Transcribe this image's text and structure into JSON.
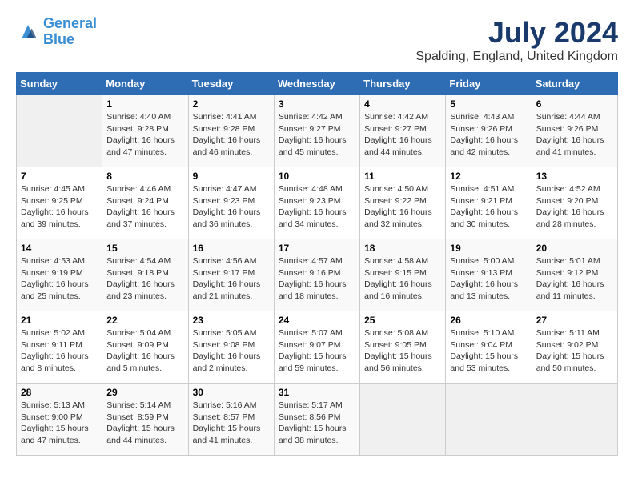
{
  "header": {
    "logo_line1": "General",
    "logo_line2": "Blue",
    "month": "July 2024",
    "location": "Spalding, England, United Kingdom"
  },
  "weekdays": [
    "Sunday",
    "Monday",
    "Tuesday",
    "Wednesday",
    "Thursday",
    "Friday",
    "Saturday"
  ],
  "weeks": [
    [
      {
        "day": "",
        "info": ""
      },
      {
        "day": "1",
        "info": "Sunrise: 4:40 AM\nSunset: 9:28 PM\nDaylight: 16 hours\nand 47 minutes."
      },
      {
        "day": "2",
        "info": "Sunrise: 4:41 AM\nSunset: 9:28 PM\nDaylight: 16 hours\nand 46 minutes."
      },
      {
        "day": "3",
        "info": "Sunrise: 4:42 AM\nSunset: 9:27 PM\nDaylight: 16 hours\nand 45 minutes."
      },
      {
        "day": "4",
        "info": "Sunrise: 4:42 AM\nSunset: 9:27 PM\nDaylight: 16 hours\nand 44 minutes."
      },
      {
        "day": "5",
        "info": "Sunrise: 4:43 AM\nSunset: 9:26 PM\nDaylight: 16 hours\nand 42 minutes."
      },
      {
        "day": "6",
        "info": "Sunrise: 4:44 AM\nSunset: 9:26 PM\nDaylight: 16 hours\nand 41 minutes."
      }
    ],
    [
      {
        "day": "7",
        "info": "Sunrise: 4:45 AM\nSunset: 9:25 PM\nDaylight: 16 hours\nand 39 minutes."
      },
      {
        "day": "8",
        "info": "Sunrise: 4:46 AM\nSunset: 9:24 PM\nDaylight: 16 hours\nand 37 minutes."
      },
      {
        "day": "9",
        "info": "Sunrise: 4:47 AM\nSunset: 9:23 PM\nDaylight: 16 hours\nand 36 minutes."
      },
      {
        "day": "10",
        "info": "Sunrise: 4:48 AM\nSunset: 9:23 PM\nDaylight: 16 hours\nand 34 minutes."
      },
      {
        "day": "11",
        "info": "Sunrise: 4:50 AM\nSunset: 9:22 PM\nDaylight: 16 hours\nand 32 minutes."
      },
      {
        "day": "12",
        "info": "Sunrise: 4:51 AM\nSunset: 9:21 PM\nDaylight: 16 hours\nand 30 minutes."
      },
      {
        "day": "13",
        "info": "Sunrise: 4:52 AM\nSunset: 9:20 PM\nDaylight: 16 hours\nand 28 minutes."
      }
    ],
    [
      {
        "day": "14",
        "info": "Sunrise: 4:53 AM\nSunset: 9:19 PM\nDaylight: 16 hours\nand 25 minutes."
      },
      {
        "day": "15",
        "info": "Sunrise: 4:54 AM\nSunset: 9:18 PM\nDaylight: 16 hours\nand 23 minutes."
      },
      {
        "day": "16",
        "info": "Sunrise: 4:56 AM\nSunset: 9:17 PM\nDaylight: 16 hours\nand 21 minutes."
      },
      {
        "day": "17",
        "info": "Sunrise: 4:57 AM\nSunset: 9:16 PM\nDaylight: 16 hours\nand 18 minutes."
      },
      {
        "day": "18",
        "info": "Sunrise: 4:58 AM\nSunset: 9:15 PM\nDaylight: 16 hours\nand 16 minutes."
      },
      {
        "day": "19",
        "info": "Sunrise: 5:00 AM\nSunset: 9:13 PM\nDaylight: 16 hours\nand 13 minutes."
      },
      {
        "day": "20",
        "info": "Sunrise: 5:01 AM\nSunset: 9:12 PM\nDaylight: 16 hours\nand 11 minutes."
      }
    ],
    [
      {
        "day": "21",
        "info": "Sunrise: 5:02 AM\nSunset: 9:11 PM\nDaylight: 16 hours\nand 8 minutes."
      },
      {
        "day": "22",
        "info": "Sunrise: 5:04 AM\nSunset: 9:09 PM\nDaylight: 16 hours\nand 5 minutes."
      },
      {
        "day": "23",
        "info": "Sunrise: 5:05 AM\nSunset: 9:08 PM\nDaylight: 16 hours\nand 2 minutes."
      },
      {
        "day": "24",
        "info": "Sunrise: 5:07 AM\nSunset: 9:07 PM\nDaylight: 15 hours\nand 59 minutes."
      },
      {
        "day": "25",
        "info": "Sunrise: 5:08 AM\nSunset: 9:05 PM\nDaylight: 15 hours\nand 56 minutes."
      },
      {
        "day": "26",
        "info": "Sunrise: 5:10 AM\nSunset: 9:04 PM\nDaylight: 15 hours\nand 53 minutes."
      },
      {
        "day": "27",
        "info": "Sunrise: 5:11 AM\nSunset: 9:02 PM\nDaylight: 15 hours\nand 50 minutes."
      }
    ],
    [
      {
        "day": "28",
        "info": "Sunrise: 5:13 AM\nSunset: 9:00 PM\nDaylight: 15 hours\nand 47 minutes."
      },
      {
        "day": "29",
        "info": "Sunrise: 5:14 AM\nSunset: 8:59 PM\nDaylight: 15 hours\nand 44 minutes."
      },
      {
        "day": "30",
        "info": "Sunrise: 5:16 AM\nSunset: 8:57 PM\nDaylight: 15 hours\nand 41 minutes."
      },
      {
        "day": "31",
        "info": "Sunrise: 5:17 AM\nSunset: 8:56 PM\nDaylight: 15 hours\nand 38 minutes."
      },
      {
        "day": "",
        "info": ""
      },
      {
        "day": "",
        "info": ""
      },
      {
        "day": "",
        "info": ""
      }
    ]
  ]
}
